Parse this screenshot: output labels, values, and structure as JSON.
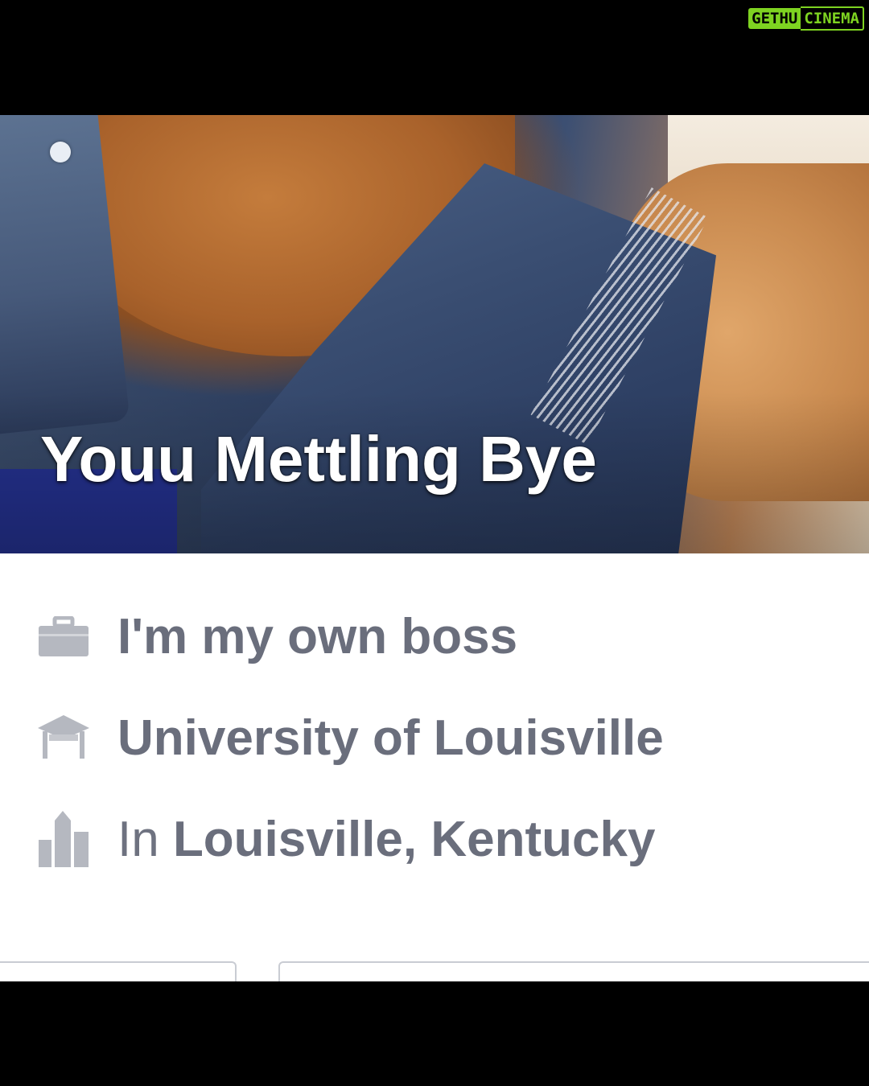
{
  "watermark": {
    "part_a": "GETHU",
    "part_b": "CINEMA"
  },
  "profile": {
    "name": "Youu Mettling Bye"
  },
  "info": {
    "work": {
      "icon": "briefcase-icon",
      "text": "I'm my own boss"
    },
    "education": {
      "icon": "graduation-cap-icon",
      "text": "University of Louisville"
    },
    "location": {
      "icon": "city-icon",
      "prefix": "In ",
      "text": "Louisville, Kentucky"
    }
  },
  "colors": {
    "info_text": "#6e7280",
    "icon": "#b5b8c0",
    "watermark_green": "#7ed321"
  }
}
